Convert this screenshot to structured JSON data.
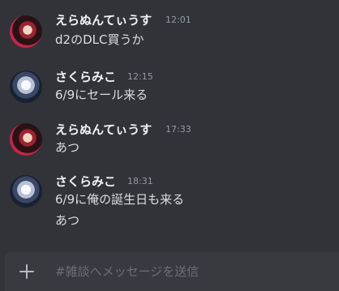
{
  "messages": [
    {
      "author": "えらぬんてぃうす",
      "time": "12:01",
      "lines": [
        "d2のDLC買うか"
      ],
      "avatar": "elanuntius-avatar"
    },
    {
      "author": "さくらみこ",
      "time": "12:15",
      "lines": [
        "6/9にセール来る"
      ],
      "avatar": "sakuramiko-avatar"
    },
    {
      "author": "えらぬんてぃうす",
      "time": "17:33",
      "lines": [
        "あつ"
      ],
      "avatar": "elanuntius-avatar"
    },
    {
      "author": "さくらみこ",
      "time": "18:31",
      "lines": [
        "6/9に俺の誕生日も来る",
        "あつ"
      ],
      "avatar": "sakuramiko-avatar"
    }
  ],
  "composer": {
    "placeholder": "#雑談へメッセージを送信",
    "attach_icon": "plus-icon"
  },
  "colors": {
    "background": "#313338",
    "composer": "#383a40",
    "username": "#f2f3f5",
    "timestamp": "#949ba4",
    "text": "#dbdee1"
  }
}
